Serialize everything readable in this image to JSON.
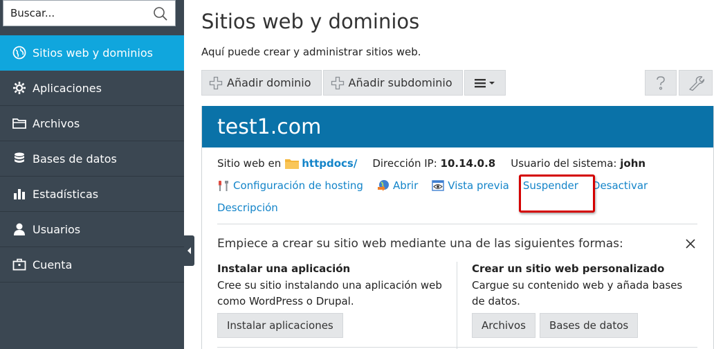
{
  "sidebar": {
    "search_placeholder": "Buscar...",
    "items": [
      {
        "label": "Sitios web y dominios",
        "icon": "globe-icon",
        "active": true
      },
      {
        "label": "Aplicaciones",
        "icon": "gear-icon"
      },
      {
        "label": "Archivos",
        "icon": "folder-icon"
      },
      {
        "label": "Bases de datos",
        "icon": "database-icon"
      },
      {
        "label": "Estadísticas",
        "icon": "bar-chart-icon"
      },
      {
        "label": "Usuarios",
        "icon": "user-icon"
      },
      {
        "label": "Cuenta",
        "icon": "briefcase-icon"
      }
    ]
  },
  "main": {
    "title": "Sitios web y dominios",
    "description": "Aquí puede crear y administrar sitios web.",
    "toolbar": {
      "add_domain": "Añadir dominio",
      "add_subdomain": "Añadir subdominio"
    }
  },
  "domain": {
    "name": "test1.com",
    "site_label": "Sitio web en",
    "docroot": "httpdocs/",
    "ip_label": "Dirección IP:",
    "ip": "10.14.0.8",
    "user_label": "Usuario del sistema:",
    "user": "john",
    "actions": {
      "hosting": "Configuración de hosting",
      "open": "Abrir",
      "preview": "Vista previa",
      "suspend": "Suspender",
      "deactivate": "Desactivar",
      "description": "Descripción"
    },
    "getting_started": {
      "title": "Empiece a crear su sitio web mediante una de las siguientes formas:",
      "install_title": "Instalar una aplicación",
      "install_text": "Cree su sitio instalando una aplicación web como WordPress o Drupal.",
      "install_button": "Instalar aplicaciones",
      "custom_title": "Crear un sitio web personalizado",
      "custom_text": "Cargue su contenido web y añada bases de datos.",
      "files_button": "Archivos",
      "db_button": "Bases de datos"
    }
  },
  "colors": {
    "sidebar_bg": "#3b4752",
    "active_item": "#10a6dd",
    "card_header": "#0a72a8",
    "link": "#1384c9",
    "highlight": "#d40000"
  }
}
